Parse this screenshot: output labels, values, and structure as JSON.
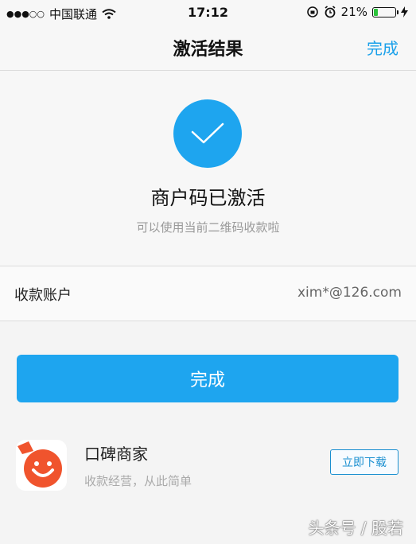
{
  "status_bar": {
    "carrier": "中国联通",
    "time": "17:12",
    "battery_percent": "21%"
  },
  "nav": {
    "title": "激活结果",
    "done_label": "完成"
  },
  "result": {
    "title": "商户码已激活",
    "subtitle": "可以使用当前二维码收款啦"
  },
  "account": {
    "label": "收款账户",
    "value": "xim*@126.com"
  },
  "primary_button": {
    "label": "完成"
  },
  "promo": {
    "app_name": "口碑商家",
    "description": "收款经营，从此简单",
    "download_label": "立即下载"
  },
  "watermark": "头条号 / 股若",
  "colors": {
    "accent": "#1ea5ef",
    "battery": "#2bc33b",
    "app_icon": "#f0542d"
  },
  "battery_level": 0.21
}
